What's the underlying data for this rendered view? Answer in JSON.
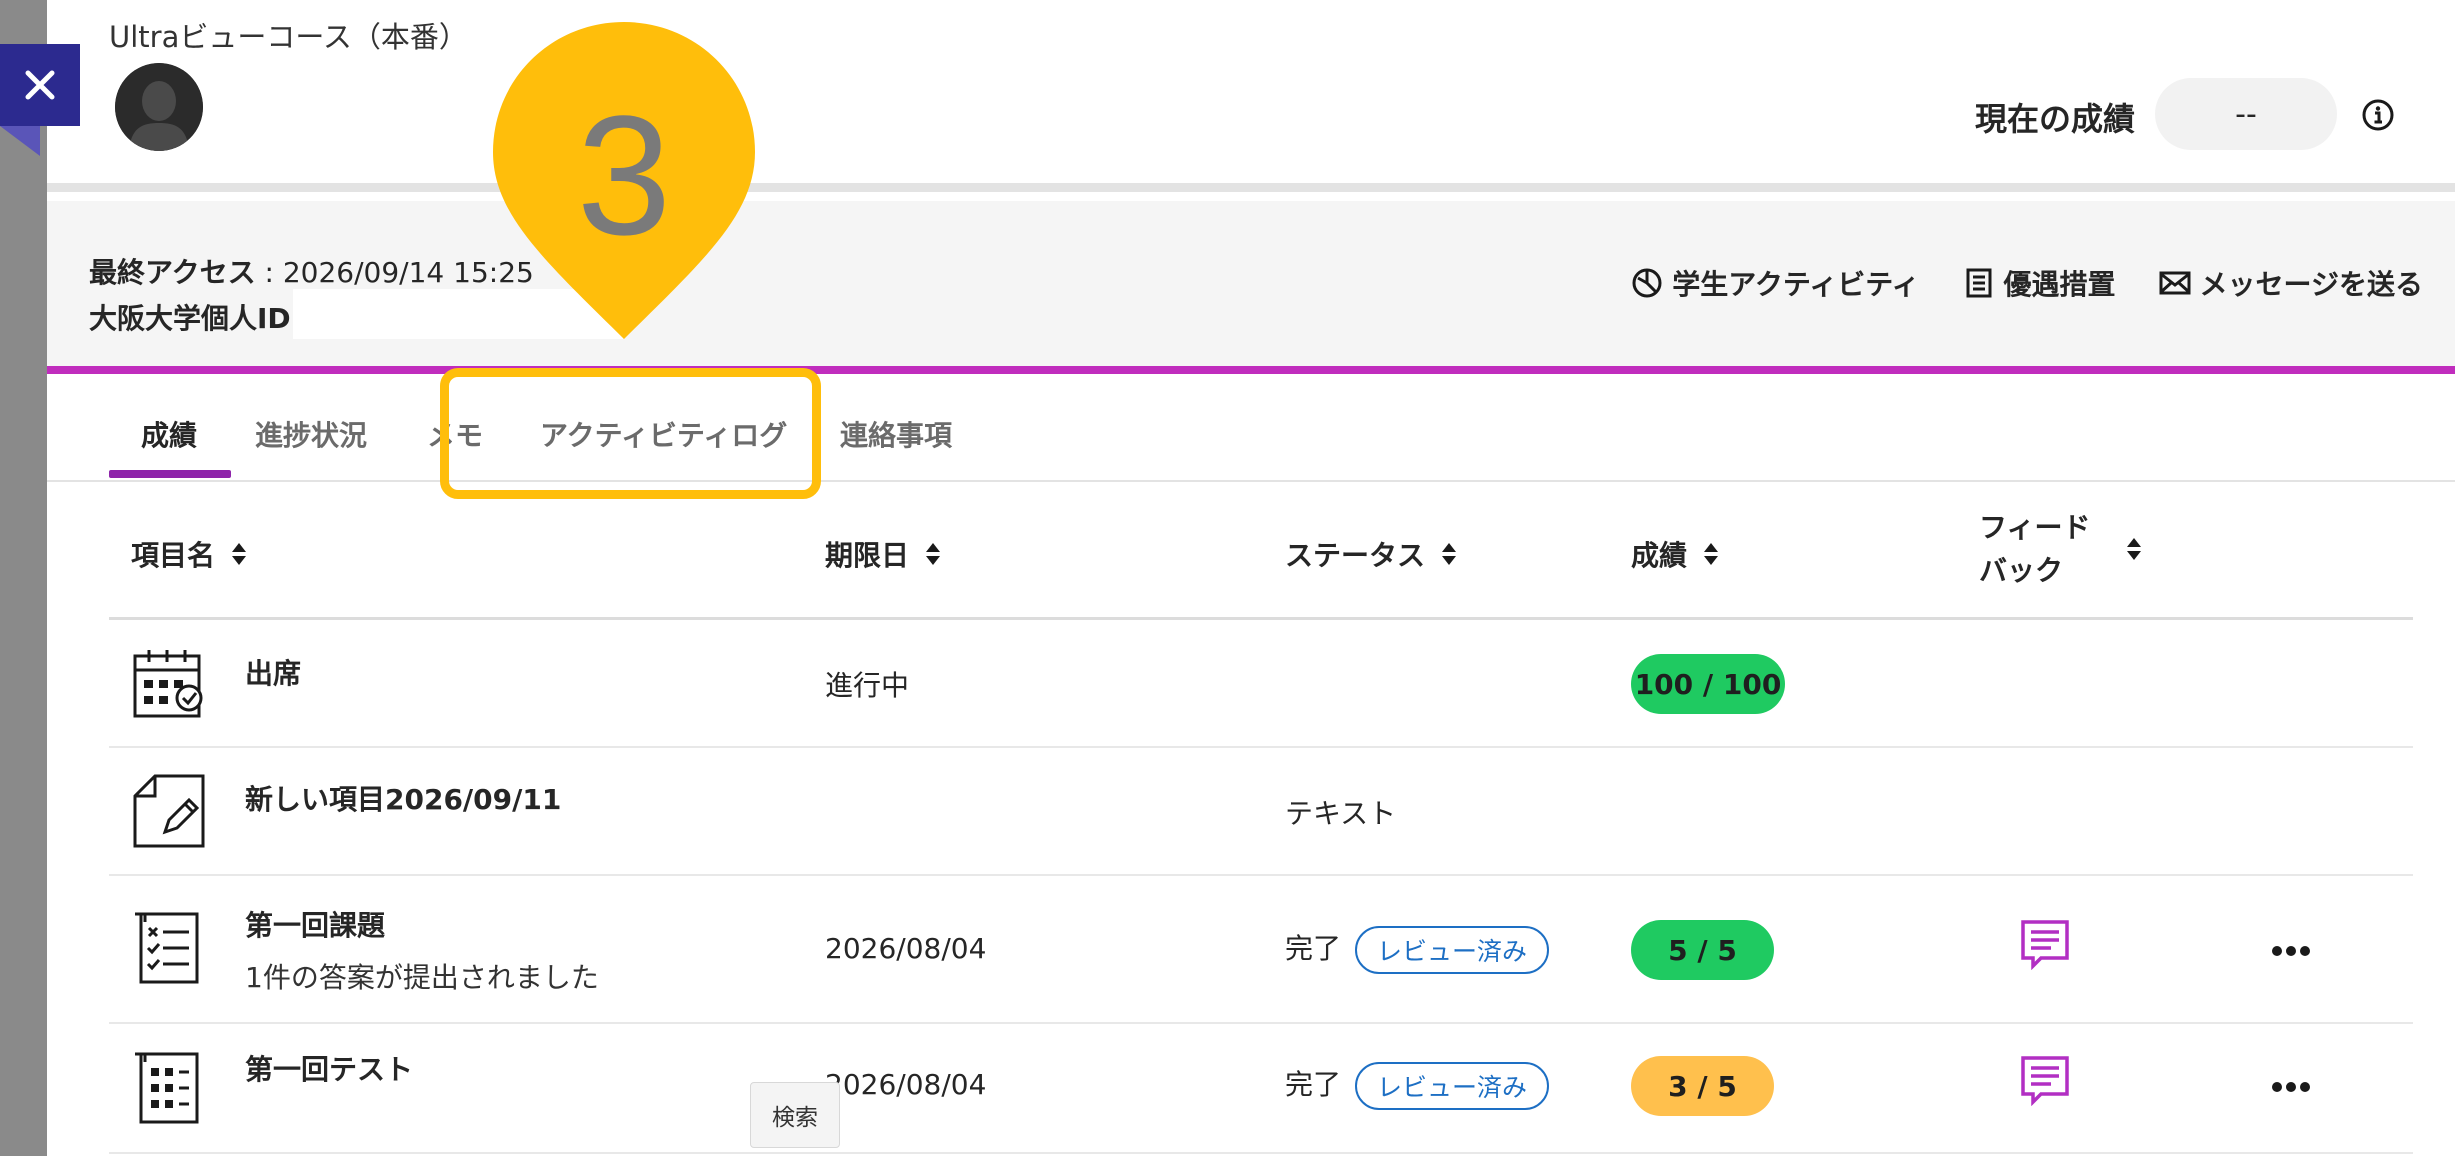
{
  "course": {
    "title": "Ultraビューコース（本番）"
  },
  "grade": {
    "label": "現在の成績",
    "value": "--"
  },
  "info": {
    "last_access_label": "最終アクセス",
    "last_access_value": "2026/09/14 15:25",
    "student_id_label": "大阪大学個人ID"
  },
  "actions": [
    {
      "label": "学生アクティビティ",
      "icon": "activity-chart-icon"
    },
    {
      "label": "優遇措置",
      "icon": "document-list-icon"
    },
    {
      "label": "メッセージを送る",
      "icon": "envelope-icon"
    }
  ],
  "tabs": [
    {
      "label": "成績",
      "active": true
    },
    {
      "label": "進捗状況"
    },
    {
      "label": "メモ"
    },
    {
      "label": "アクティビティログ"
    },
    {
      "label": "連絡事項"
    }
  ],
  "table": {
    "headers": [
      "項目名",
      "期限日",
      "ステータス",
      "成績",
      "フィード",
      "バック"
    ],
    "rows": [
      {
        "name": "出席",
        "sub": "",
        "due": "進行中",
        "status": "",
        "badge": "",
        "grade": "100 / 100",
        "grade_color": "#1fca61",
        "icon": "attendance-calendar-icon",
        "feedback": false,
        "more": false
      },
      {
        "name": "新しい項目2026/09/11",
        "sub": "",
        "due": "",
        "status": "テキスト",
        "badge": "",
        "grade": "",
        "grade_color": "",
        "icon": "document-pencil-icon",
        "feedback": false,
        "more": false
      },
      {
        "name": "第一回課題",
        "sub": "1件の答案が提出されました",
        "due": "2026/08/04",
        "status": "完了",
        "badge": "レビュー済み",
        "grade": "5 / 5",
        "grade_color": "#1fca61",
        "icon": "checklist-icon",
        "feedback": true,
        "more": true
      },
      {
        "name": "第一回テスト",
        "sub": "",
        "due": "2026/08/04",
        "status": "完了",
        "badge": "レビュー済み",
        "grade": "3 / 5",
        "grade_color": "#ffc04d",
        "icon": "test-grid-icon",
        "feedback": true,
        "more": true
      }
    ]
  },
  "tooltip": {
    "search": "検索"
  },
  "callout": {
    "number": "3"
  },
  "colors": {
    "accent": "#8e24aa",
    "close_bg": "#2c2a8f",
    "callout": "#ffbe0b",
    "band_border": "#c02dbd"
  }
}
